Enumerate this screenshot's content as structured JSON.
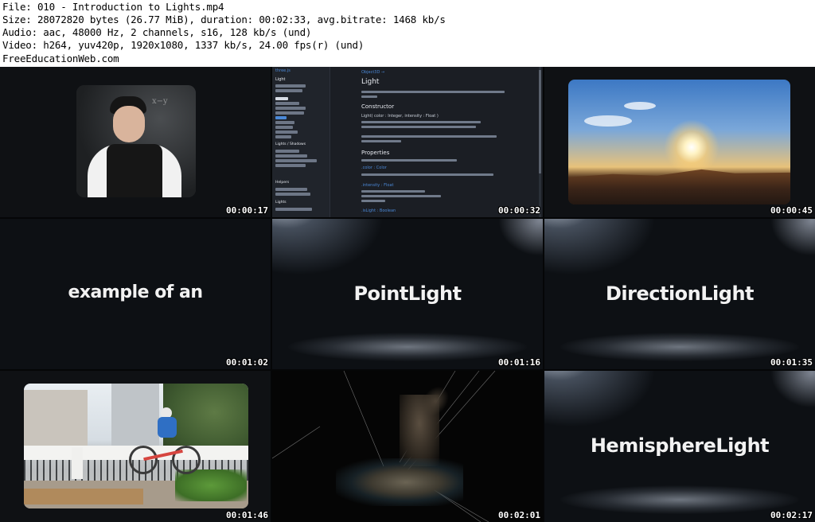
{
  "header": {
    "file_line": "File: 010 - Introduction to Lights.mp4",
    "size_line": "Size: 28072820 bytes (26.77 MiB), duration: 00:02:33, avg.bitrate: 1468 kb/s",
    "audio_line": "Audio: aac, 48000 Hz, 2 channels, s16, 128 kb/s (und)",
    "video_line": "Video: h264, yuv420p, 1920x1080, 1337 kb/s, 24.00 fps(r) (und)",
    "watermark": "FreeEducationWeb.com"
  },
  "thumbnails": [
    {
      "timestamp": "00:00:17",
      "scene": "presenter"
    },
    {
      "timestamp": "00:00:32",
      "scene": "documentation"
    },
    {
      "timestamp": "00:00:45",
      "scene": "sunset"
    },
    {
      "timestamp": "00:01:02",
      "scene": "text",
      "text": "example of an"
    },
    {
      "timestamp": "00:01:16",
      "scene": "text",
      "text": "PointLight"
    },
    {
      "timestamp": "00:01:35",
      "scene": "text",
      "text": "DirectionLight"
    },
    {
      "timestamp": "00:01:46",
      "scene": "cyclist"
    },
    {
      "timestamp": "00:02:01",
      "scene": "statue"
    },
    {
      "timestamp": "00:02:17",
      "scene": "text",
      "text": "HemisphereLight"
    }
  ],
  "docs": {
    "tab": "three.js",
    "sidebar_title": "Light",
    "sidebar_section_shadow": "Lights / Shadows",
    "sidebar_section_helpers": "Helpers",
    "sidebar_section_lights": "Lights",
    "breadcrumb": "Object3D →",
    "title": "Light",
    "constructor_heading": "Constructor",
    "constructor_sig": "Light( color : Integer, intensity : Float )",
    "properties_heading": "Properties",
    "prop_color": ".color : Color",
    "prop_intensity": ".intensity : Float",
    "prop_islight": ".isLight : Boolean"
  }
}
